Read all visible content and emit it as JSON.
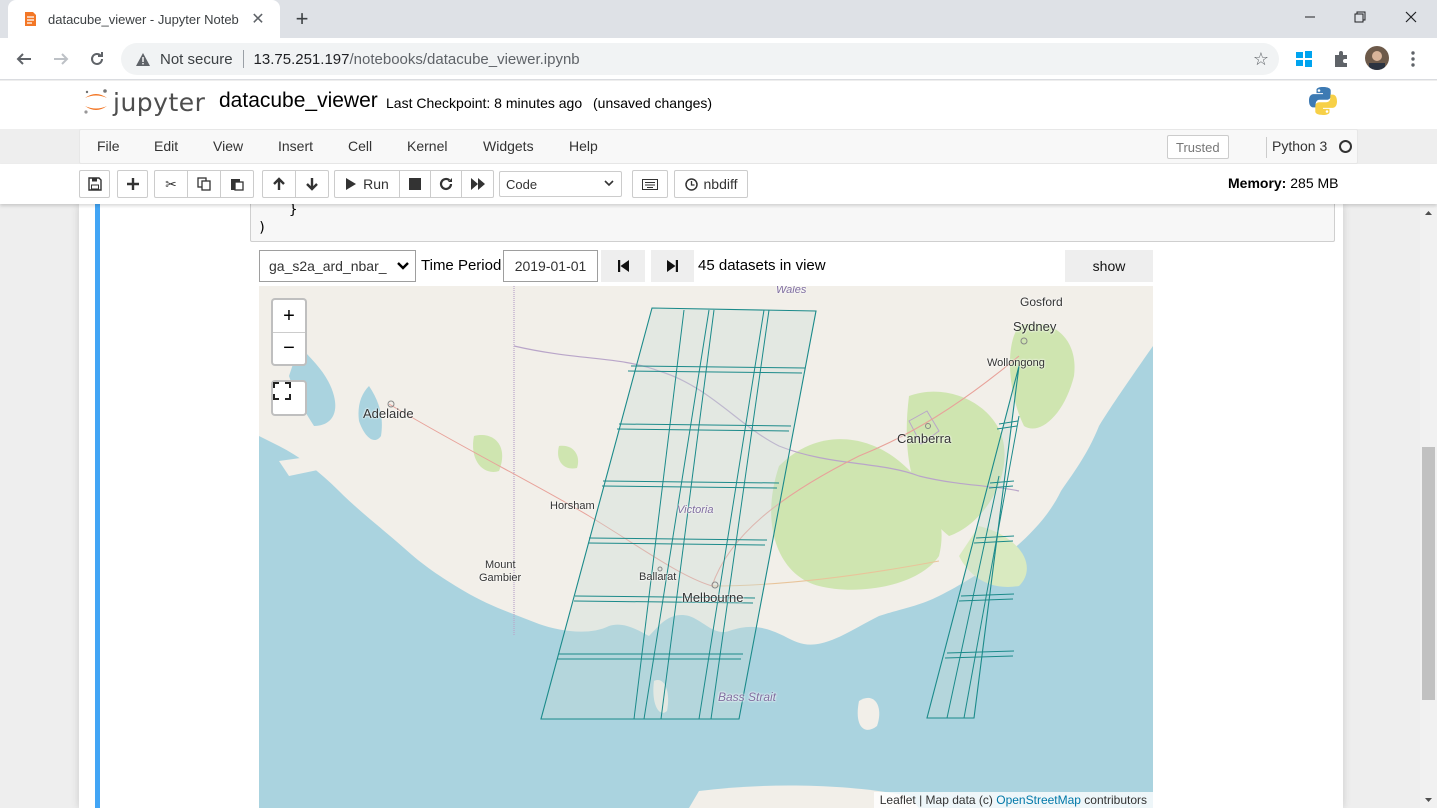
{
  "browser": {
    "tab_title": "datacube_viewer - Jupyter Noteb",
    "security_label": "Not secure",
    "url_host": "13.75.251.197",
    "url_path": "/notebooks/datacube_viewer.ipynb"
  },
  "jupyter": {
    "logo_text": "jupyter",
    "notebook_name": "datacube_viewer",
    "checkpoint": "Last Checkpoint: 8 minutes ago",
    "unsaved": "(unsaved changes)",
    "menu": [
      "File",
      "Edit",
      "View",
      "Insert",
      "Cell",
      "Kernel",
      "Widgets",
      "Help"
    ],
    "trusted_label": "Trusted",
    "kernel_name": "Python 3",
    "toolbar": {
      "run_label": "Run",
      "cell_type": "Code",
      "nbdiff_label": "nbdiff"
    },
    "memory_label": "Memory:",
    "memory_value": "285 MB"
  },
  "cell": {
    "code_line1": "}",
    "code_line2": ")"
  },
  "widget": {
    "product_select": "ga_s2a_ard_nbar_",
    "time_period_label": "Time Period",
    "date_value": "2019-01-01",
    "dataset_count": "45 datasets in view",
    "show_label": "show"
  },
  "map": {
    "labels": {
      "wales": "Wales",
      "gosford": "Gosford",
      "sydney": "Sydney",
      "wollongong": "Wollongong",
      "adelaide": "Adelaide",
      "canberra": "Canberra",
      "horsham": "Horsham",
      "victoria": "Victoria",
      "mount": "Mount",
      "gambier": "Gambier",
      "ballarat": "Ballarat",
      "melbourne": "Melbourne",
      "bass_strait": "Bass Strait"
    },
    "attribution_prefix": "Leaflet | Map data (c) ",
    "attribution_link": "OpenStreetMap",
    "attribution_suffix": " contributors",
    "colors": {
      "sea": "#aad3df",
      "land": "#f2efe9",
      "forest": "#cfe5b0",
      "footprint": "#1b8a8a"
    }
  }
}
